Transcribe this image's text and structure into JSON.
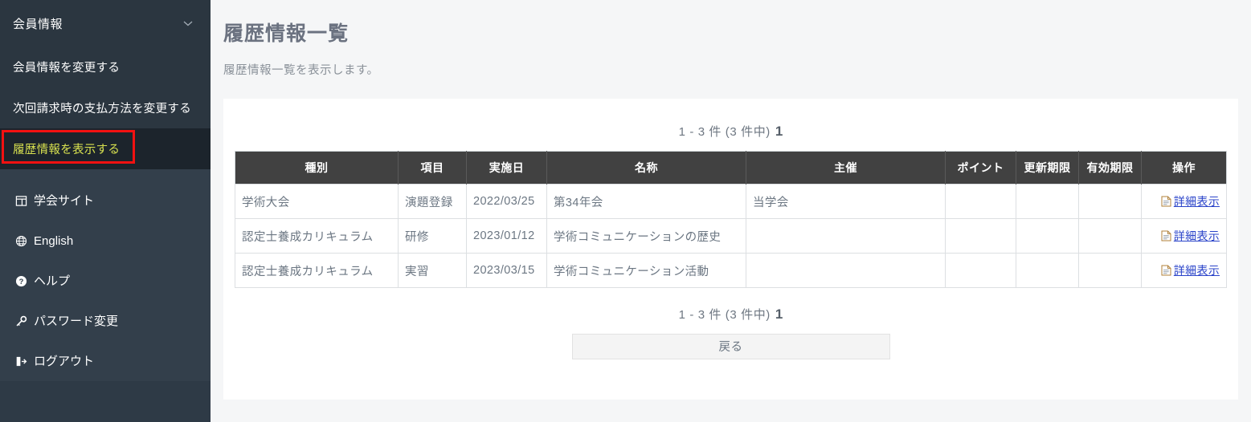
{
  "sidebar": {
    "menu_header": {
      "label": "会員情報",
      "icon": "chevron-down-icon"
    },
    "menu_items": [
      {
        "label": "会員情報を変更する",
        "active": false
      },
      {
        "label": "次回請求時の支払方法を変更する",
        "active": false
      },
      {
        "label": "履歴情報を表示する",
        "active": true
      }
    ],
    "links": [
      {
        "label": "学会サイト",
        "icon": "window-icon"
      },
      {
        "label": "English",
        "icon": "globe-icon"
      },
      {
        "label": "ヘルプ",
        "icon": "question-circle-icon"
      },
      {
        "label": "パスワード変更",
        "icon": "key-icon"
      },
      {
        "label": "ログアウト",
        "icon": "logout-icon"
      }
    ],
    "highlight_color": "#f21111",
    "active_text_color": "#d7e04f",
    "background_color": "#2b3640"
  },
  "main": {
    "title": "履歴情報一覧",
    "description": "履歴情報一覧を表示します。",
    "pager_top": {
      "range": "1 - 3 件 (3 件中)",
      "page": "1"
    },
    "pager_bottom": {
      "range": "1 - 3 件 (3 件中)",
      "page": "1"
    },
    "table": {
      "columns": [
        "種別",
        "項目",
        "実施日",
        "名称",
        "主催",
        "ポイント",
        "更新期限",
        "有効期限",
        "操作"
      ],
      "rows": [
        {
          "種別": "学術大会",
          "項目": "演題登録",
          "実施日": "2022/03/25",
          "名称": "第34年会",
          "主催": "当学会",
          "ポイント": "",
          "更新期限": "",
          "有効期限": "",
          "操作": "詳細表示"
        },
        {
          "種別": "認定士養成カリキュラム",
          "項目": "研修",
          "実施日": "2023/01/12",
          "名称": "学術コミュニケーションの歴史",
          "主催": "",
          "ポイント": "",
          "更新期限": "",
          "有効期限": "",
          "操作": "詳細表示"
        },
        {
          "種別": "認定士養成カリキュラム",
          "項目": "実習",
          "実施日": "2023/03/15",
          "名称": "学術コミュニケーション活動",
          "主催": "",
          "ポイント": "",
          "更新期限": "",
          "有効期限": "",
          "操作": "詳細表示"
        }
      ]
    },
    "back_button": "戻る",
    "header_bg_color": "#414141",
    "link_color": "#2a43c9"
  }
}
